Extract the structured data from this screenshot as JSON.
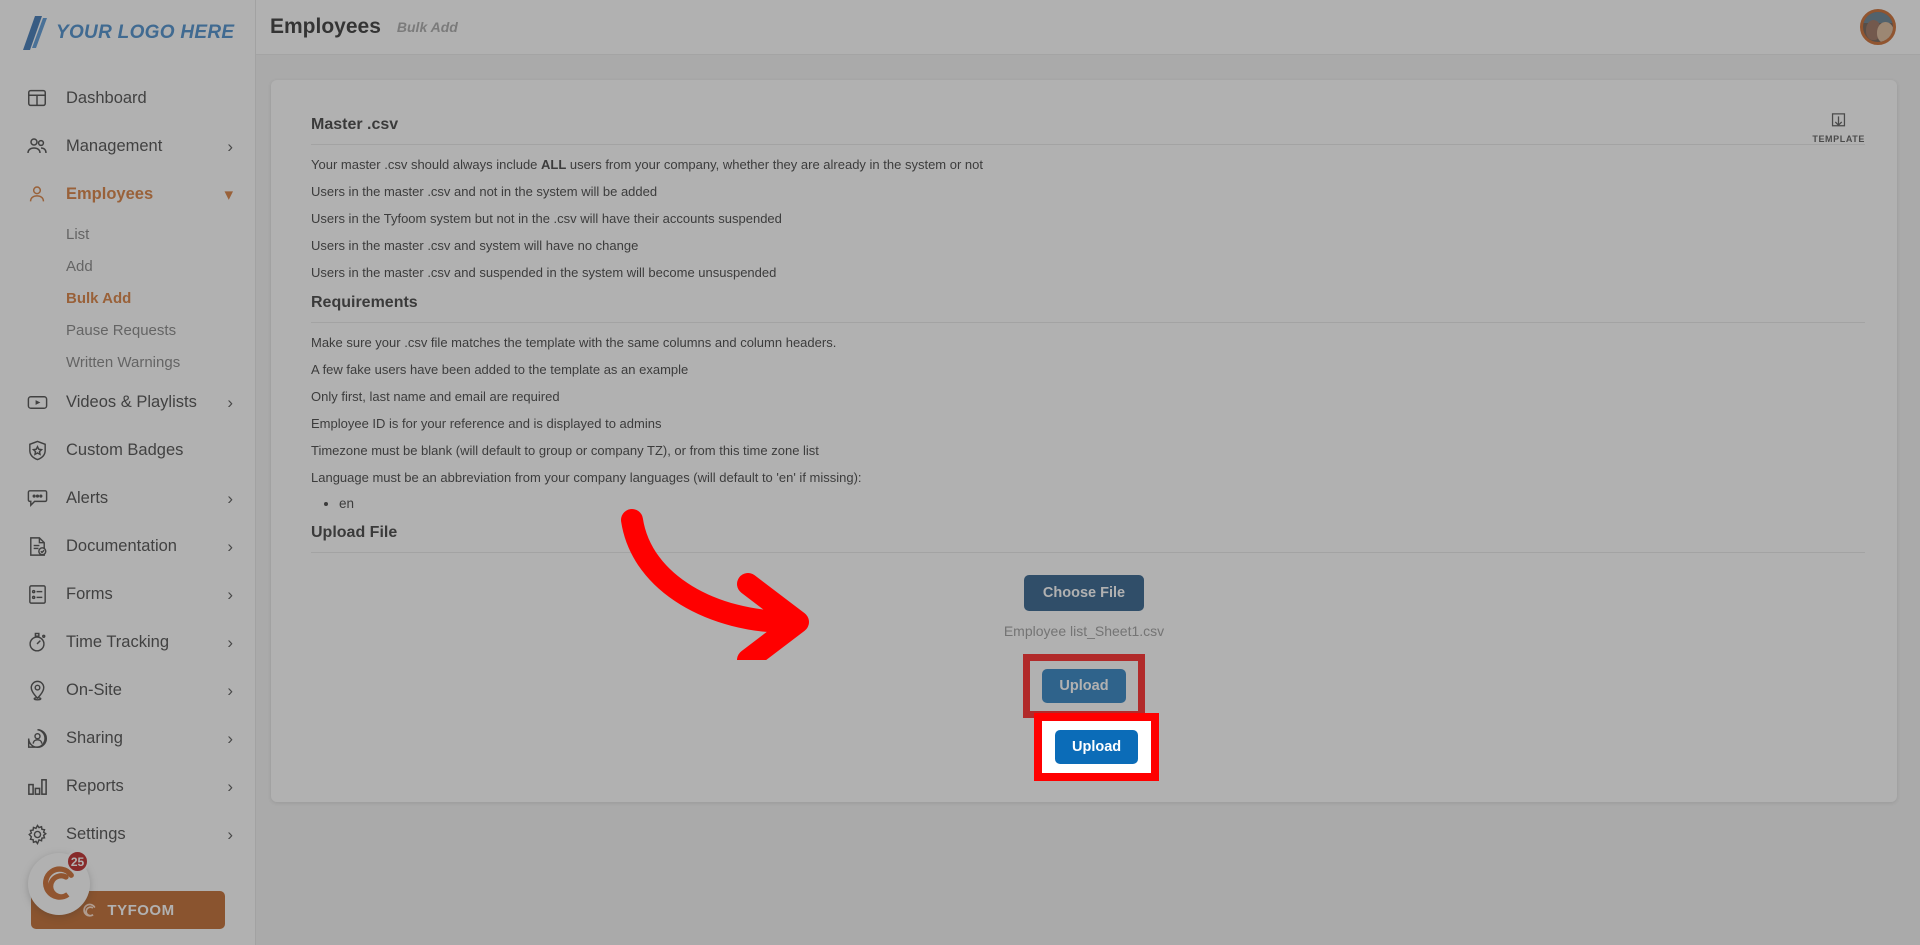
{
  "sidebar": {
    "logo_text": "YOUR LOGO HERE",
    "items": [
      {
        "label": "Dashboard",
        "icon": "dashboard-icon",
        "chevron": "",
        "active": false
      },
      {
        "label": "Management",
        "icon": "people-icon",
        "chevron": "›",
        "active": false
      },
      {
        "label": "Employees",
        "icon": "person-icon",
        "chevron": "⌄",
        "active": true
      },
      {
        "label": "Videos & Playlists",
        "icon": "video-icon",
        "chevron": "›",
        "active": false
      },
      {
        "label": "Custom Badges",
        "icon": "badge-icon",
        "chevron": "",
        "active": false
      },
      {
        "label": "Alerts",
        "icon": "alert-chat-icon",
        "chevron": "›",
        "active": false
      },
      {
        "label": "Documentation",
        "icon": "document-icon",
        "chevron": "›",
        "active": false
      },
      {
        "label": "Forms",
        "icon": "forms-icon",
        "chevron": "›",
        "active": false
      },
      {
        "label": "Time Tracking",
        "icon": "stopwatch-icon",
        "chevron": "›",
        "active": false
      },
      {
        "label": "On-Site",
        "icon": "location-pin-icon",
        "chevron": "›",
        "active": false
      },
      {
        "label": "Sharing",
        "icon": "share-user-icon",
        "chevron": "›",
        "active": false
      },
      {
        "label": "Reports",
        "icon": "bar-chart-icon",
        "chevron": "›",
        "active": false
      },
      {
        "label": "Settings",
        "icon": "gear-icon",
        "chevron": "›",
        "active": false
      }
    ],
    "employees_sub": [
      {
        "label": "List",
        "active": false
      },
      {
        "label": "Add",
        "active": false
      },
      {
        "label": "Bulk Add",
        "active": true
      },
      {
        "label": "Pause Requests",
        "active": false
      },
      {
        "label": "Written Warnings",
        "active": false
      }
    ],
    "tyfoom": {
      "label": "TYFOOM",
      "badge_count": "25"
    }
  },
  "header": {
    "title": "Employees",
    "subtitle": "Bulk Add"
  },
  "card": {
    "template_label": "TEMPLATE",
    "master_csv": {
      "heading": "Master .csv",
      "lines": [
        "Your master .csv should always include ALL users from your company, whether they are already in the system or not",
        "Users in the master .csv and not in the system will be added",
        "Users in the Tyfoom system but not in the .csv will have their accounts suspended",
        "Users in the master .csv and system will have no change",
        "Users in the master .csv and suspended in the system will become unsuspended"
      ],
      "bold_word": "ALL"
    },
    "requirements": {
      "heading": "Requirements",
      "lines": [
        "Make sure your .csv file matches the template with the same columns and column headers.",
        "A few fake users have been added to the template as an example",
        "Only first, last name and email are required",
        "Employee ID is for your reference and is displayed to admins",
        "Timezone must be blank (will default to group or company TZ), or from this time zone list",
        "Language must be an abbreviation from your company languages (will default to 'en' if missing):"
      ],
      "languages": [
        "en"
      ]
    },
    "upload": {
      "heading": "Upload File",
      "choose_file_label": "Choose File",
      "file_name": "Employee list_Sheet1.csv",
      "upload_label": "Upload"
    }
  },
  "annotation": {
    "arrow_color": "#ff0000",
    "highlight_color": "#ff0000"
  },
  "colors": {
    "accent_orange": "#d2691e",
    "primary_blue": "#0b6cb8",
    "dark_blue": "#0c4477",
    "tyfoom_orange": "#b5500a"
  }
}
